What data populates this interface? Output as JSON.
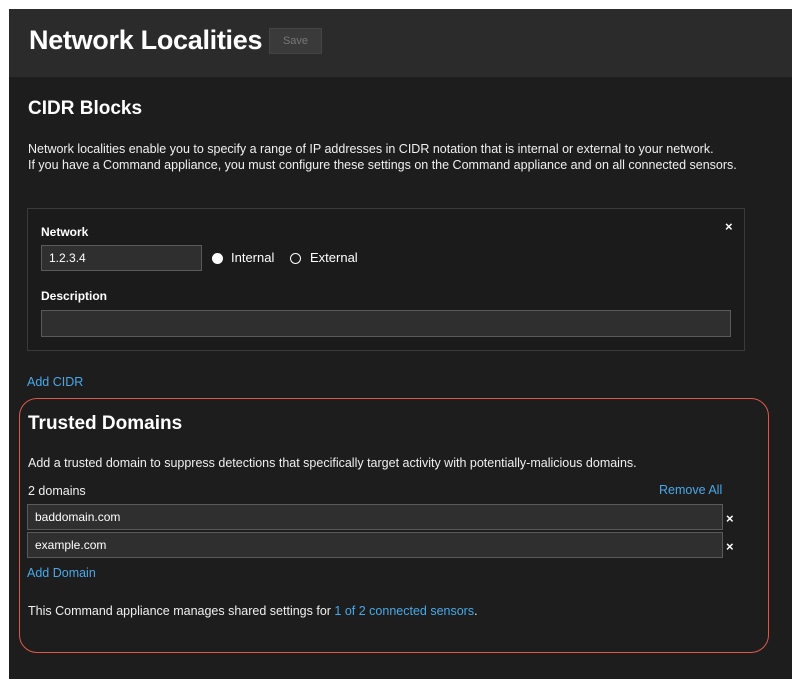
{
  "header": {
    "title": "Network Localities",
    "save_label": "Save"
  },
  "cidr": {
    "title": "CIDR Blocks",
    "description_line1": "Network localities enable you to specify a range of IP addresses in CIDR notation that is internal or external to your network.",
    "description_line2": "If you have a Command appliance, you must configure these settings on the Command appliance and on all connected sensors.",
    "entry": {
      "network_label": "Network",
      "network_value": "1.2.3.4",
      "internal_label": "Internal",
      "external_label": "External",
      "selected": "Internal",
      "description_label": "Description",
      "description_value": "",
      "remove_icon": "×"
    },
    "add_label": "Add CIDR"
  },
  "trusted": {
    "title": "Trusted Domains",
    "description": "Add a trusted domain to suppress detections that specifically target activity with potentially-malicious domains.",
    "count_label": "2 domains",
    "remove_all_label": "Remove All",
    "domains": [
      "baddomain.com",
      "example.com"
    ],
    "remove_icon": "×",
    "add_label": "Add Domain",
    "footer_text": "This Command appliance manages shared settings for",
    "footer_link": "1 of 2 connected sensors",
    "footer_end": "."
  },
  "colors": {
    "link": "#4aa8e8",
    "highlight": "#e0584a",
    "background": "#1d1d1d",
    "header": "#2b2b2b"
  }
}
